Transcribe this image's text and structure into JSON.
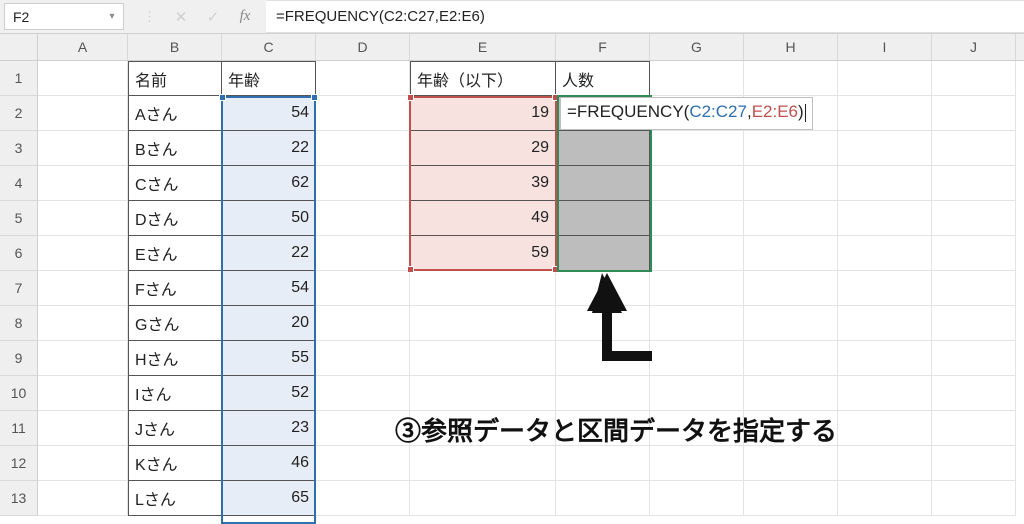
{
  "formula_bar": {
    "name_box": "F2",
    "formula": "=FREQUENCY(C2:C27,E2:E6)"
  },
  "in_cell_formula": {
    "prefix": "=FREQUENCY(",
    "ref1": "C2:C27",
    "comma": ",",
    "ref2": "E2:E6",
    "suffix": ")"
  },
  "columns": [
    "A",
    "B",
    "C",
    "D",
    "E",
    "F",
    "G",
    "H",
    "I",
    "J"
  ],
  "row_nums": [
    "1",
    "2",
    "3",
    "4",
    "5",
    "6",
    "7",
    "8",
    "9",
    "10",
    "11",
    "12",
    "13"
  ],
  "headers": {
    "b1": "名前",
    "c1": "年齢",
    "e1": "年齢（以下）",
    "f1": "人数"
  },
  "names": [
    "Aさん",
    "Bさん",
    "Cさん",
    "Dさん",
    "Eさん",
    "Fさん",
    "Gさん",
    "Hさん",
    "Iさん",
    "Jさん",
    "Kさん",
    "Lさん"
  ],
  "ages": [
    "54",
    "22",
    "62",
    "50",
    "22",
    "54",
    "20",
    "55",
    "52",
    "23",
    "46",
    "65"
  ],
  "bins": [
    "19",
    "29",
    "39",
    "49",
    "59"
  ],
  "annotation": "③参照データと区間データを指定する"
}
